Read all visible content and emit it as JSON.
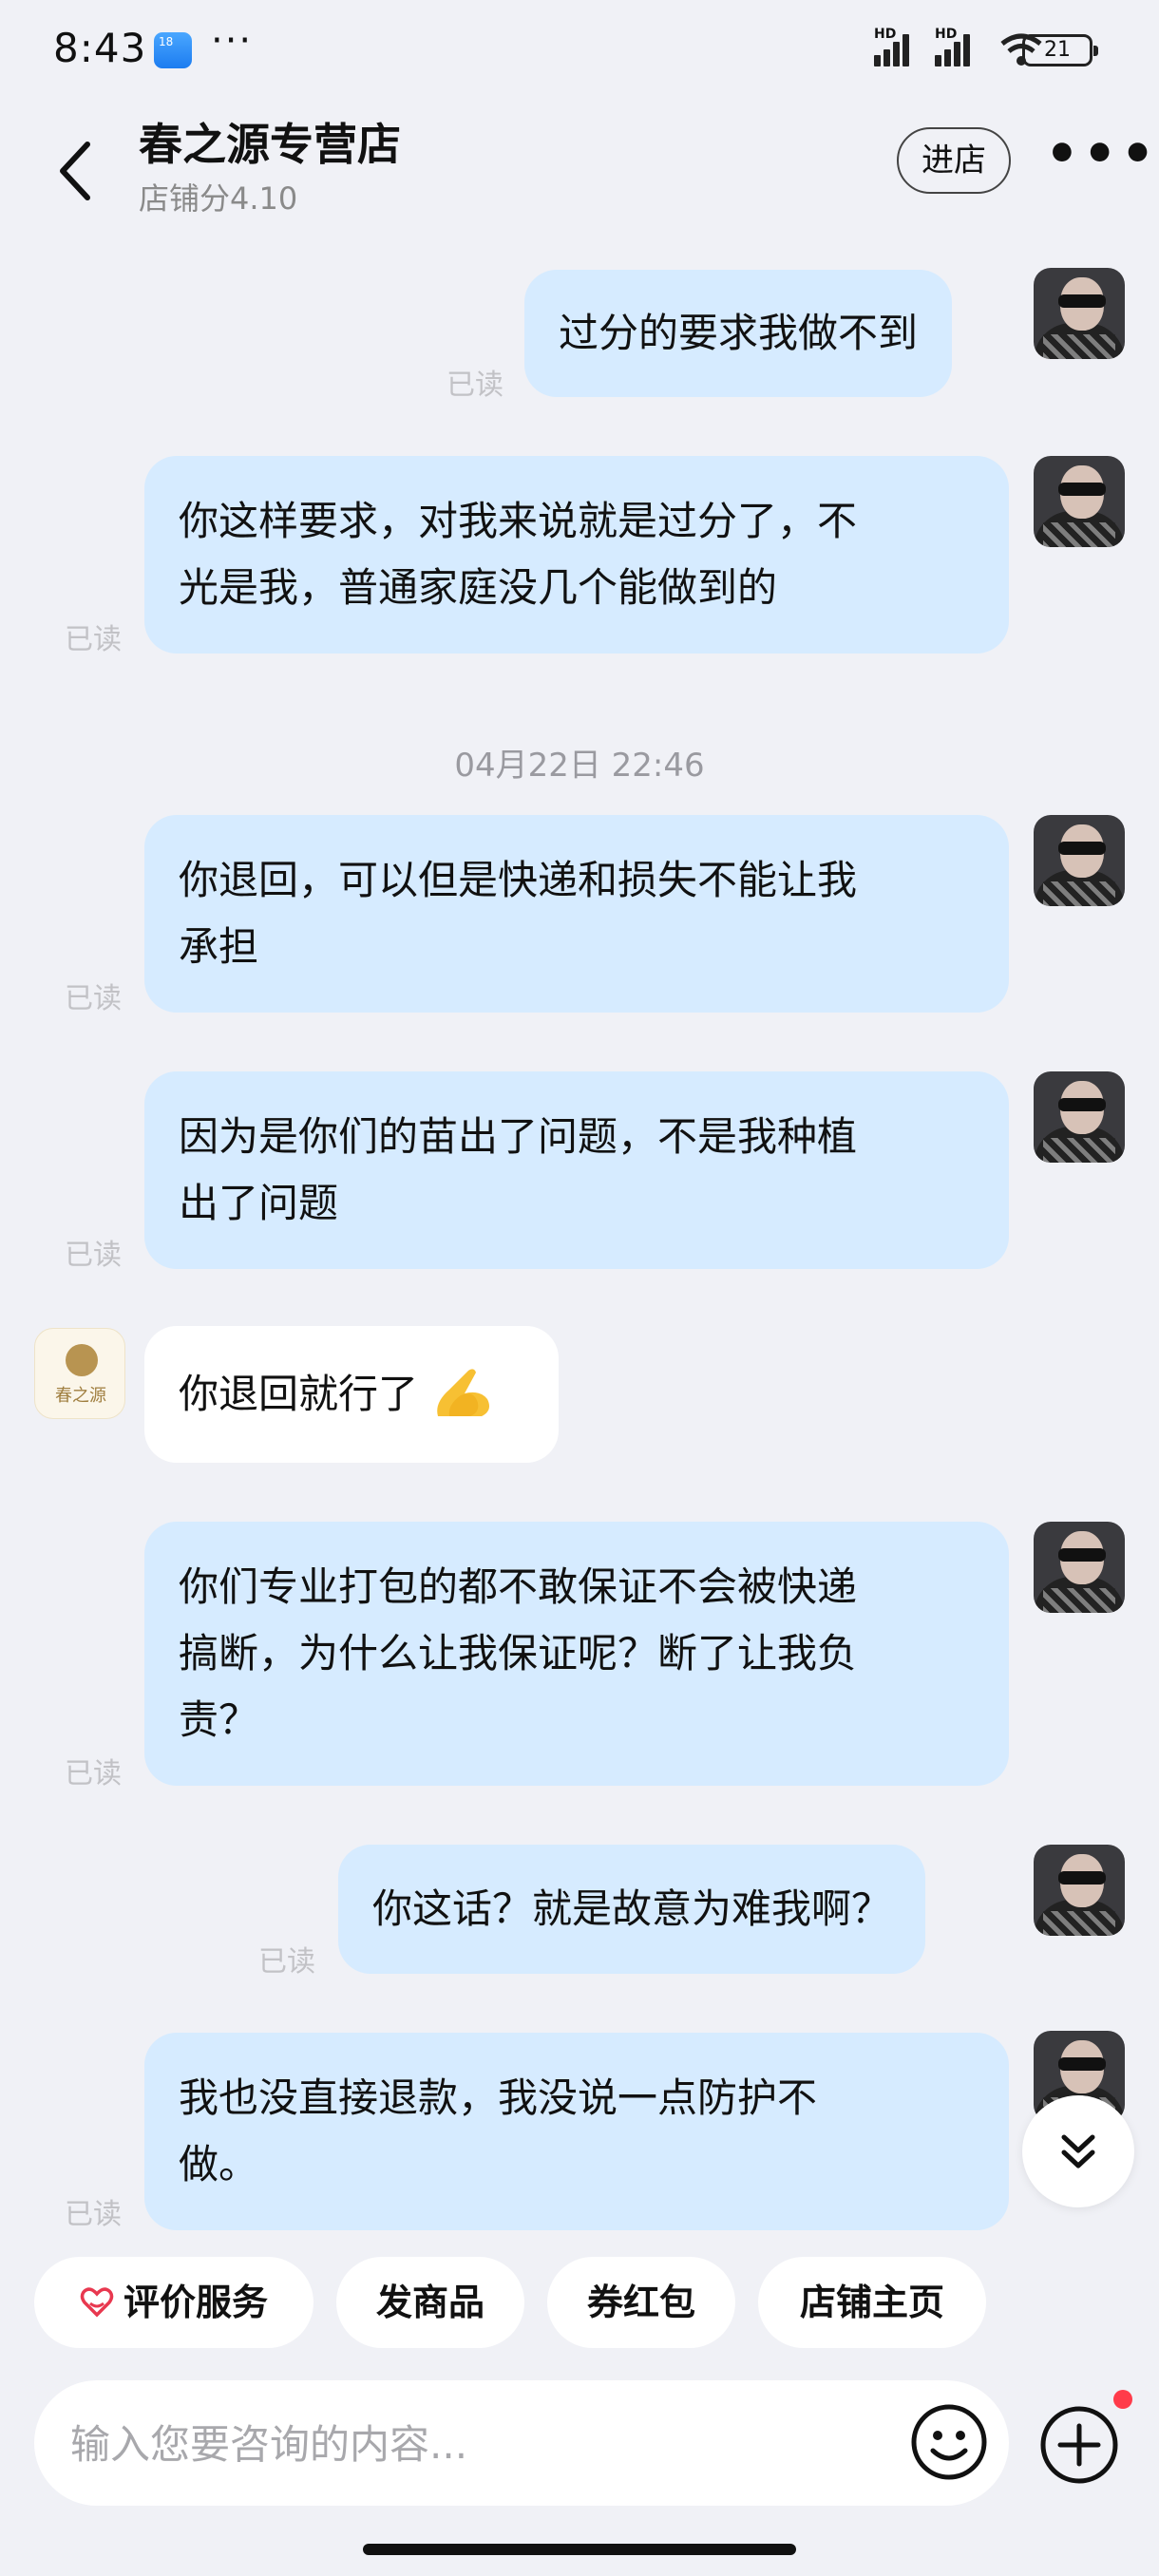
{
  "status_bar": {
    "time": "8:43",
    "notif_badge": "18",
    "more": "···",
    "battery": "21",
    "signal_label": "HD"
  },
  "header": {
    "shop_name": "春之源专营店",
    "shop_score": "店铺分4.10",
    "enter_store": "进店",
    "more": "•••"
  },
  "chat": {
    "timestamp": "04月22日 22:46",
    "read_label": "已读",
    "messages": [
      {
        "from": "me",
        "lines": [
          "过分的要求我做不到"
        ]
      },
      {
        "from": "me",
        "lines": [
          "你这样要求，对我来说就是过分了，不",
          "光是我，普通家庭没几个能做到的"
        ]
      },
      {
        "from": "me",
        "lines": [
          "你退回，可以但是快递和损失不能让我",
          "承担"
        ]
      },
      {
        "from": "me",
        "lines": [
          "因为是你们的苗出了问题，不是我种植",
          "出了问题"
        ]
      },
      {
        "from": "shop",
        "lines": [
          "你退回就行了"
        ],
        "emoji": "praying-hands-emoji"
      },
      {
        "from": "me",
        "lines": [
          "你们专业打包的都不敢保证不会被快递",
          "搞断，为什么让我保证呢？断了让我负",
          "责？"
        ]
      },
      {
        "from": "me",
        "lines": [
          "你这话？就是故意为难我啊？"
        ]
      },
      {
        "from": "me",
        "lines": [
          "我也没直接退款，我没说一点防护不",
          "做。"
        ]
      }
    ],
    "shop_avatar_text": "春之源"
  },
  "quick_actions": [
    "评价服务",
    "发商品",
    "券红包",
    "店铺主页"
  ],
  "input": {
    "placeholder": "输入您要咨询的内容..."
  },
  "colors": {
    "my_bubble": "#d6ebff",
    "shop_bubble": "#ffffff",
    "background": "#f0f1f6",
    "notify_dot": "#ff3b4a",
    "heart": "#e8384f"
  }
}
